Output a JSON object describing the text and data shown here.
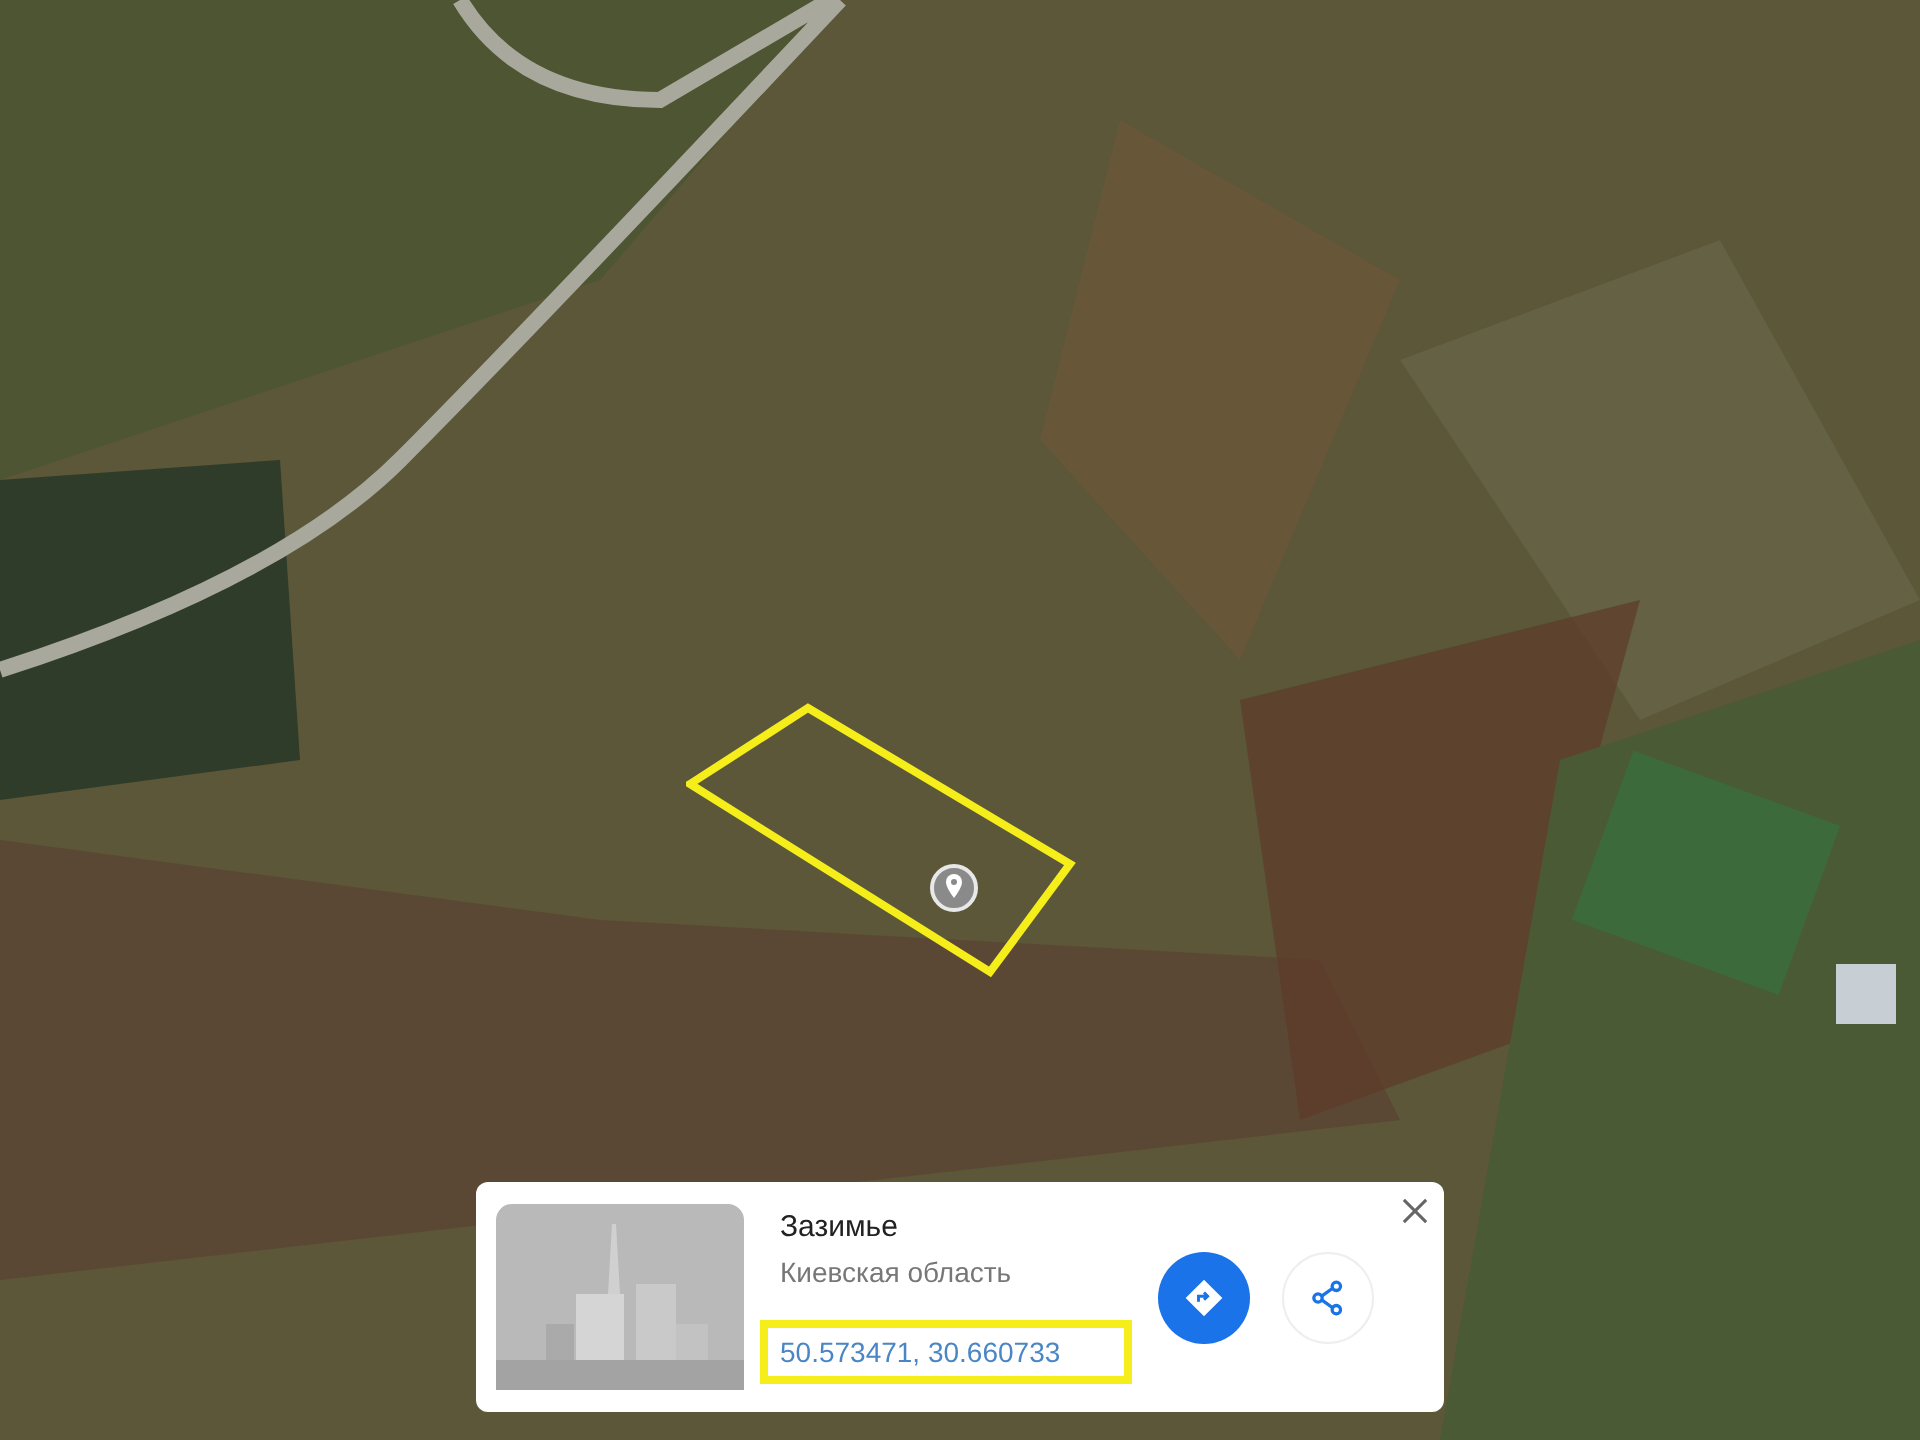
{
  "place_card": {
    "name": "Зазимье",
    "region": "Киевская область",
    "coordinates": "50.573471, 30.660733"
  }
}
